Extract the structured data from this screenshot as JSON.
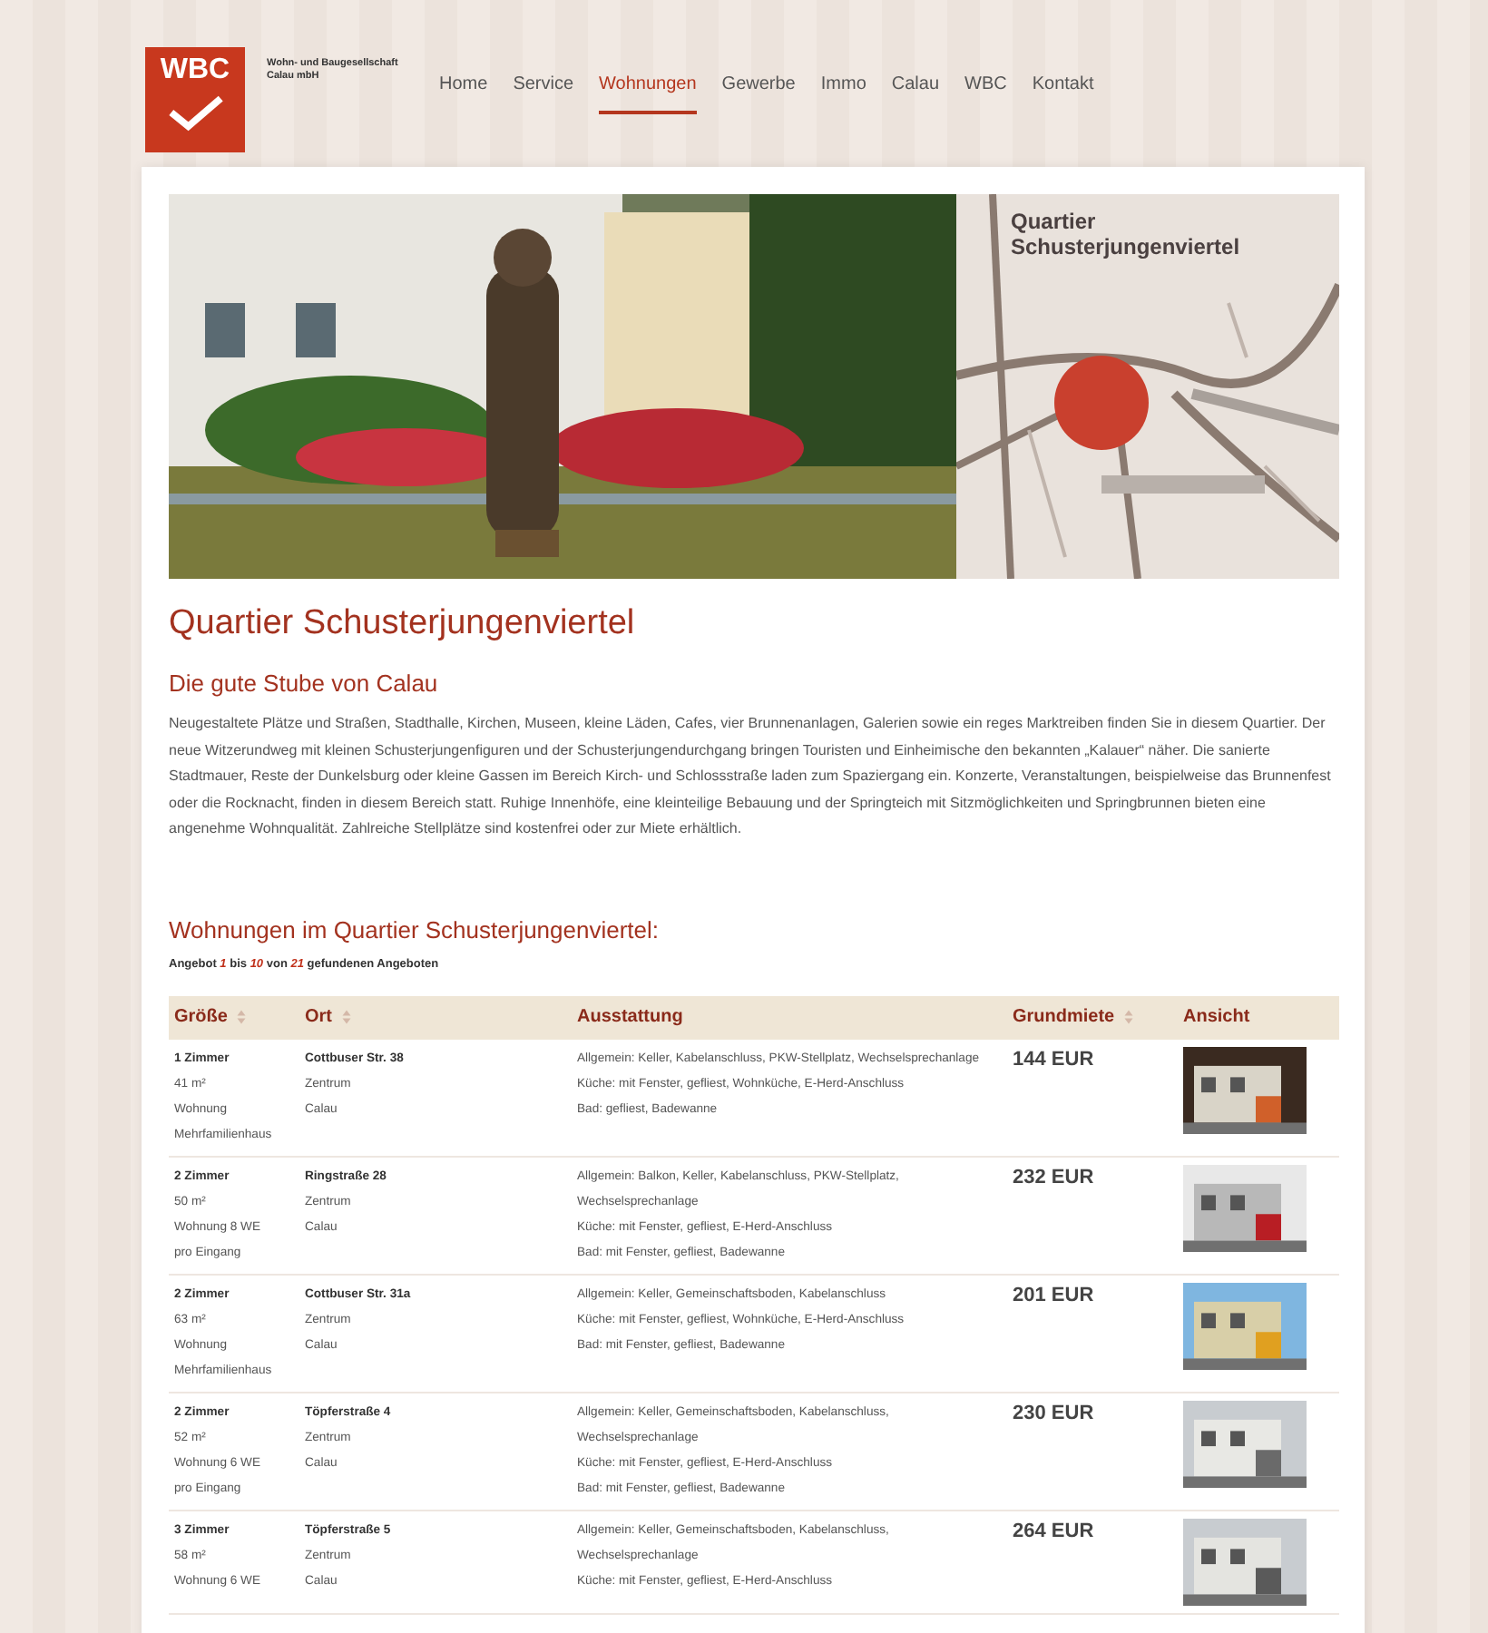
{
  "logo": {
    "mark": "WBC",
    "company": "Wohn- und Baugesellschaft Calau mbH"
  },
  "nav": [
    {
      "label": "Home",
      "selected": false
    },
    {
      "label": "Service",
      "selected": false
    },
    {
      "label": "Wohnungen",
      "selected": true
    },
    {
      "label": "Gewerbe",
      "selected": false
    },
    {
      "label": "Immo",
      "selected": false
    },
    {
      "label": "Calau",
      "selected": false
    },
    {
      "label": "WBC",
      "selected": false
    },
    {
      "label": "Kontakt",
      "selected": false
    }
  ],
  "banner": {
    "map_title": "Quartier Schusterjungenviertel"
  },
  "title": "Quartier Schusterjungenviertel",
  "subtitle": "Die gute Stube von Calau",
  "intro": "Neugestaltete Plätze und Straßen, Stadthalle, Kirchen, Museen, kleine Läden, Cafes, vier Brunnenanlagen, Galerien sowie ein reges Marktreiben finden Sie in diesem Quartier. Der neue Witzerundweg mit kleinen Schusterjungenfiguren und der Schusterjungendurchgang bringen Touristen und Einheimische den bekannten „Kalauer“ näher. Die sanierte Stadtmauer, Reste der Dunkelsburg oder kleine Gassen im Bereich Kirch- und Schlossstraße laden zum Spaziergang ein. Konzerte, Veranstaltungen, beispielweise das Brunnenfest oder die Rocknacht, finden in diesem Bereich statt. Ruhige Innenhöfe, eine kleinteilige Bebauung und der Springteich mit Sitzmöglichkeiten und Springbrunnen bieten eine angenehme Wohnqualität. Zahlreiche Stellplätze sind kostenfrei oder zur Miete erhältlich.",
  "listing_title": "Wohnungen im Quartier Schusterjungenviertel:",
  "result_count": [
    {
      "text": "Angebot ",
      "kind": "plain"
    },
    {
      "text": "1",
      "kind": "number"
    },
    {
      "text": " bis ",
      "kind": "plain"
    },
    {
      "text": "10",
      "kind": "number"
    },
    {
      "text": " von ",
      "kind": "plain"
    },
    {
      "text": "21",
      "kind": "number"
    },
    {
      "text": " gefundenen Angeboten",
      "kind": "plain"
    }
  ],
  "table": {
    "columns": [
      {
        "label": "Größe",
        "sortable": true
      },
      {
        "label": "Ort",
        "sortable": true
      },
      {
        "label": "Ausstattung",
        "sortable": false
      },
      {
        "label": "Grundmiete",
        "sortable": true
      },
      {
        "label": "Ansicht",
        "sortable": false
      }
    ],
    "rows": [
      {
        "size": [
          "1 Zimmer",
          "41 m²",
          "Wohnung",
          "Mehrfamilienhaus"
        ],
        "place": [
          "Cottbuser Str. 38",
          "Zentrum",
          "Calau"
        ],
        "features": [
          "Allgemein: Keller, Kabelanschluss, PKW-Stellplatz, Wechselsprechanlage",
          "Küche: mit Fenster, gefliest, Wohnküche, E-Herd-Anschluss",
          "Bad: gefliest, Badewanne"
        ],
        "rent": "144 EUR"
      },
      {
        "size": [
          "2 Zimmer",
          "50 m²",
          "Wohnung 8 WE",
          "pro Eingang"
        ],
        "place": [
          "Ringstraße 28",
          "Zentrum",
          "Calau"
        ],
        "features": [
          "Allgemein: Balkon, Keller, Kabelanschluss, PKW-Stellplatz, Wechselsprechanlage",
          "Küche: mit Fenster, gefliest, E-Herd-Anschluss",
          "Bad: mit Fenster, gefliest, Badewanne"
        ],
        "rent": "232 EUR"
      },
      {
        "size": [
          "2 Zimmer",
          "63 m²",
          "Wohnung",
          "Mehrfamilienhaus"
        ],
        "place": [
          "Cottbuser Str. 31a",
          "Zentrum",
          "Calau"
        ],
        "features": [
          "Allgemein: Keller, Gemeinschaftsboden, Kabelanschluss",
          "Küche: mit Fenster, gefliest, Wohnküche, E-Herd-Anschluss",
          "Bad: mit Fenster, gefliest, Badewanne"
        ],
        "rent": "201 EUR"
      },
      {
        "size": [
          "2 Zimmer",
          "52 m²",
          "Wohnung 6 WE",
          "pro Eingang"
        ],
        "place": [
          "Töpferstraße 4",
          "Zentrum",
          "Calau"
        ],
        "features": [
          "Allgemein: Keller, Gemeinschaftsboden, Kabelanschluss, Wechselsprechanlage",
          "Küche: mit Fenster, gefliest, E-Herd-Anschluss",
          "Bad: mit Fenster, gefliest, Badewanne"
        ],
        "rent": "230 EUR"
      },
      {
        "size": [
          "3 Zimmer",
          "58 m²",
          "Wohnung 6 WE"
        ],
        "place": [
          "Töpferstraße 5",
          "Zentrum",
          "Calau"
        ],
        "features": [
          "Allgemein: Keller, Gemeinschaftsboden, Kabelanschluss, Wechselsprechanlage",
          "Küche: mit Fenster, gefliest, E-Herd-Anschluss"
        ],
        "rent": "264 EUR"
      }
    ]
  }
}
